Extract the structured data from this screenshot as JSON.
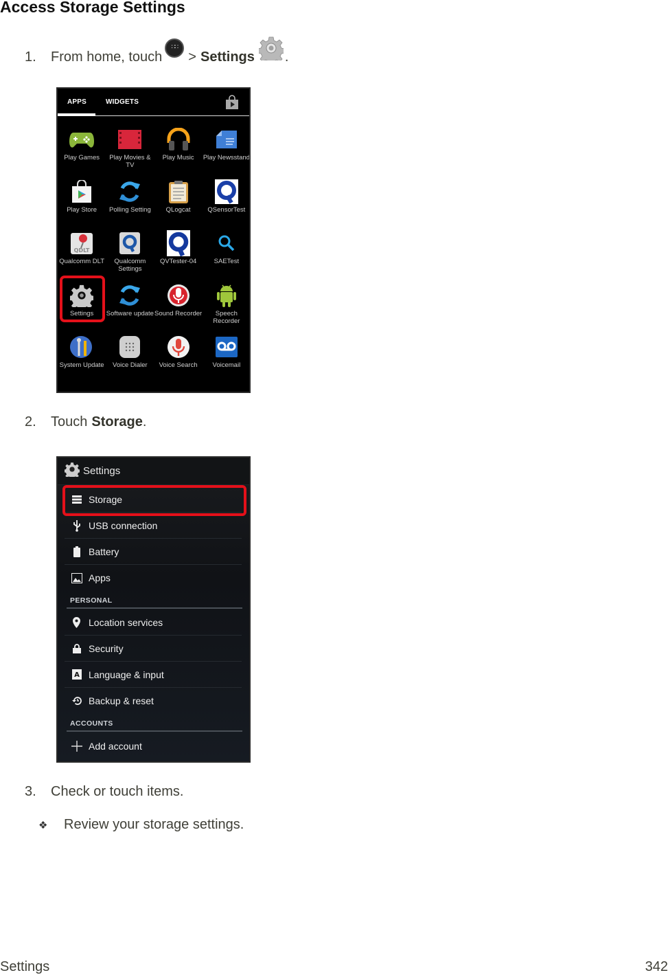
{
  "title": "Access Storage Settings",
  "steps": [
    {
      "number": "1.",
      "text_before": "From home, touch",
      "separator": ">",
      "bold": "Settings",
      "text_after": ".",
      "icons": [
        "apps-icon",
        "gear-icon"
      ]
    },
    {
      "number": "2.",
      "text_before": "Touch",
      "bold": "Storage",
      "text_after": "."
    },
    {
      "number": "3.",
      "text": "Check or touch items."
    }
  ],
  "sub_bullet": {
    "bullet": "❖",
    "text": "Review your storage settings."
  },
  "app_drawer": {
    "tabs": [
      {
        "label": "APPS",
        "active": true
      },
      {
        "label": "WIDGETS",
        "active": false
      }
    ],
    "store_icon": "play-store-bag-icon",
    "highlighted_app": "Settings",
    "apps": [
      {
        "label": "Play Games",
        "icon": "play-games-icon"
      },
      {
        "label": "Play Movies & TV",
        "icon": "play-movies-icon"
      },
      {
        "label": "Play Music",
        "icon": "play-music-icon"
      },
      {
        "label": "Play Newsstand",
        "icon": "play-newsstand-icon"
      },
      {
        "label": "Play Store",
        "icon": "play-store-icon"
      },
      {
        "label": "Polling Setting",
        "icon": "polling-setting-icon"
      },
      {
        "label": "QLogcat",
        "icon": "qlogcat-icon"
      },
      {
        "label": "QSensorTest",
        "icon": "qsensortest-icon"
      },
      {
        "label": "Qualcomm DLT",
        "icon": "qualcomm-dlt-icon"
      },
      {
        "label": "Qualcomm Settings",
        "icon": "qualcomm-settings-icon"
      },
      {
        "label": "QVTester-04",
        "icon": "qvtester-icon"
      },
      {
        "label": "SAETest",
        "icon": "saetest-icon"
      },
      {
        "label": "Settings",
        "icon": "settings-gear-icon"
      },
      {
        "label": "Software update",
        "icon": "software-update-icon"
      },
      {
        "label": "Sound Recorder",
        "icon": "sound-recorder-icon"
      },
      {
        "label": "Speech Recorder",
        "icon": "speech-recorder-icon"
      },
      {
        "label": "System Update",
        "icon": "system-update-icon"
      },
      {
        "label": "Voice Dialer",
        "icon": "voice-dialer-icon"
      },
      {
        "label": "Voice Search",
        "icon": "voice-search-icon"
      },
      {
        "label": "Voicemail",
        "icon": "voicemail-icon"
      }
    ]
  },
  "settings_screen": {
    "header": "Settings",
    "highlighted_item": "Storage",
    "items": [
      {
        "label": "Storage",
        "icon": "storage-icon"
      },
      {
        "label": "USB connection",
        "icon": "usb-icon"
      },
      {
        "label": "Battery",
        "icon": "battery-icon"
      },
      {
        "label": "Apps",
        "icon": "apps-image-icon"
      }
    ],
    "sections": [
      {
        "title": "PERSONAL",
        "items": [
          {
            "label": "Location services",
            "icon": "location-pin-icon"
          },
          {
            "label": "Security",
            "icon": "lock-icon"
          },
          {
            "label": "Language & input",
            "icon": "language-icon"
          },
          {
            "label": "Backup & reset",
            "icon": "backup-reset-icon"
          }
        ]
      },
      {
        "title": "ACCOUNTS",
        "items": [
          {
            "label": "Add account",
            "icon": "plus-icon"
          }
        ]
      }
    ]
  },
  "footer": {
    "section": "Settings",
    "page": "342"
  },
  "colors": {
    "highlight": "#e4101a",
    "text": "#3f3f37"
  }
}
